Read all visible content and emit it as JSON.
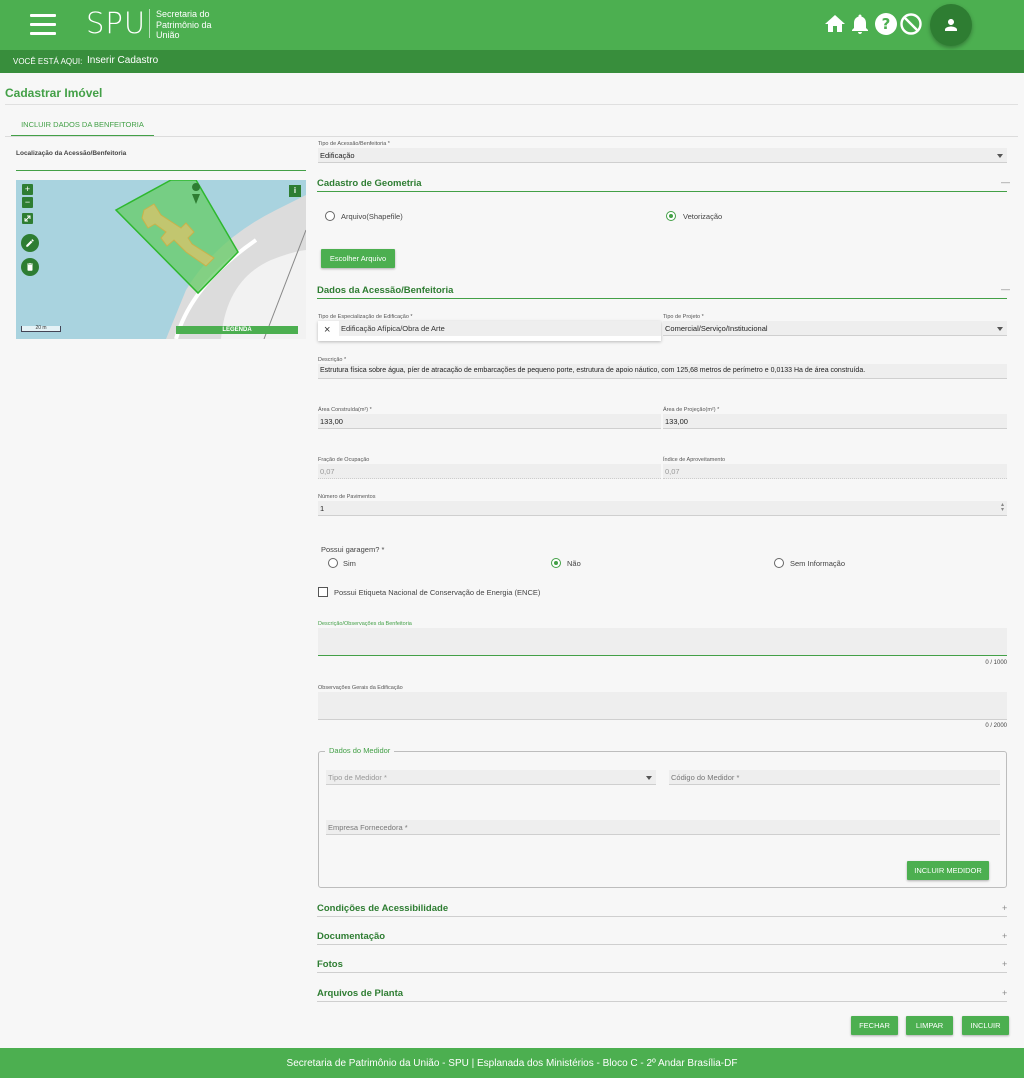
{
  "header": {
    "logo": "SPU",
    "logo_subtitle": "Secretaria do Patrimônio da União",
    "icons": [
      "home-icon",
      "bell-icon",
      "help-icon",
      "block-icon",
      "user-icon"
    ],
    "accent_color": "#4caf50"
  },
  "breadcrumb": {
    "label": "VOCÊ ESTÁ AQUI:",
    "current": "Inserir Cadastro"
  },
  "page": {
    "title": "Cadastrar Imóvel",
    "tab": "INCLUIR DADOS DA BENFEITORIA"
  },
  "map": {
    "label": "Localização da Acessão/Benfeitoria",
    "zoom_in": "+",
    "zoom_out": "−",
    "info": "i",
    "scale": "20 m",
    "legend": "LEGENDA"
  },
  "form": {
    "tipo_acessao": {
      "label": "Tipo de Acessão/Benfeitoria *",
      "value": "Edificação"
    },
    "geometria": {
      "title": "Cadastro de Geometria",
      "toggle": "—",
      "option_shapefile": "Arquivo(Shapefile)",
      "option_vetorizacao": "Vetorização",
      "selected": "Vetorização",
      "button": "Escolher Arquivo"
    },
    "dados": {
      "title": "Dados da Acessão/Benfeitoria",
      "toggle": "—",
      "tipo_especializacao": {
        "label": "Tipo de Especialização de Edificação *",
        "value": "Edificação Afípica/Obra de Arte"
      },
      "tipo_projeto": {
        "label": "Tipo de Projeto *",
        "value": "Comercial/Serviço/Institucional"
      },
      "descricao": {
        "label": "Descrição *",
        "value": "Estrutura física sobre água, píer de atracação de embarcações de pequeno porte, estrutura de apoio náutico, com 125,68 metros de perímetro e 0,0133 Ha de área construída."
      },
      "area_construida": {
        "label": "Área Construída(m²) *",
        "value": "133,00"
      },
      "area_projecao": {
        "label": "Área de Projeção(m²) *",
        "value": "133,00"
      },
      "fracao_ocupacao": {
        "label": "Fração de Ocupação",
        "value": "0,07"
      },
      "indice_aproveitamento": {
        "label": "Índice de Aproveitamento",
        "value": "0,07"
      },
      "numero_pavimentos": {
        "label": "Número de Pavimentos",
        "value": "1"
      },
      "garagem": {
        "label": "Possui garagem? *",
        "options": [
          "Sim",
          "Não",
          "Sem Informação"
        ],
        "selected": "Não"
      },
      "ence_label": "Possui Etiqueta Nacional de Conservação de Energia (ENCE)",
      "obs_benfeitoria": {
        "label": "Descrição/Observações da Benfeitoria",
        "value": "",
        "counter": "0 / 1000"
      },
      "obs_edificacao": {
        "label": "Observações Gerais da Edificação",
        "value": "",
        "counter": "0 / 2000"
      }
    },
    "medidor": {
      "legend": "Dados do Medidor",
      "tipo_placeholder": "Tipo de Medidor *",
      "codigo_placeholder": "Código do Medidor *",
      "empresa_placeholder": "Empresa Fornecedora *",
      "button": "INCLUIR MEDIDOR"
    },
    "collapsed_sections": [
      {
        "title": "Condições de Acessibilidade",
        "toggle": "+"
      },
      {
        "title": "Documentação",
        "toggle": "+"
      },
      {
        "title": "Fotos",
        "toggle": "+"
      },
      {
        "title": "Arquivos de Planta",
        "toggle": "+"
      }
    ],
    "actions": {
      "close": "FECHAR",
      "clear": "LIMPAR",
      "submit": "INCLUIR"
    }
  },
  "footer": {
    "text": "Secretaria de Patrimônio da União - SPU | Esplanada dos Ministérios - Bloco C - 2º Andar Brasília-DF"
  }
}
